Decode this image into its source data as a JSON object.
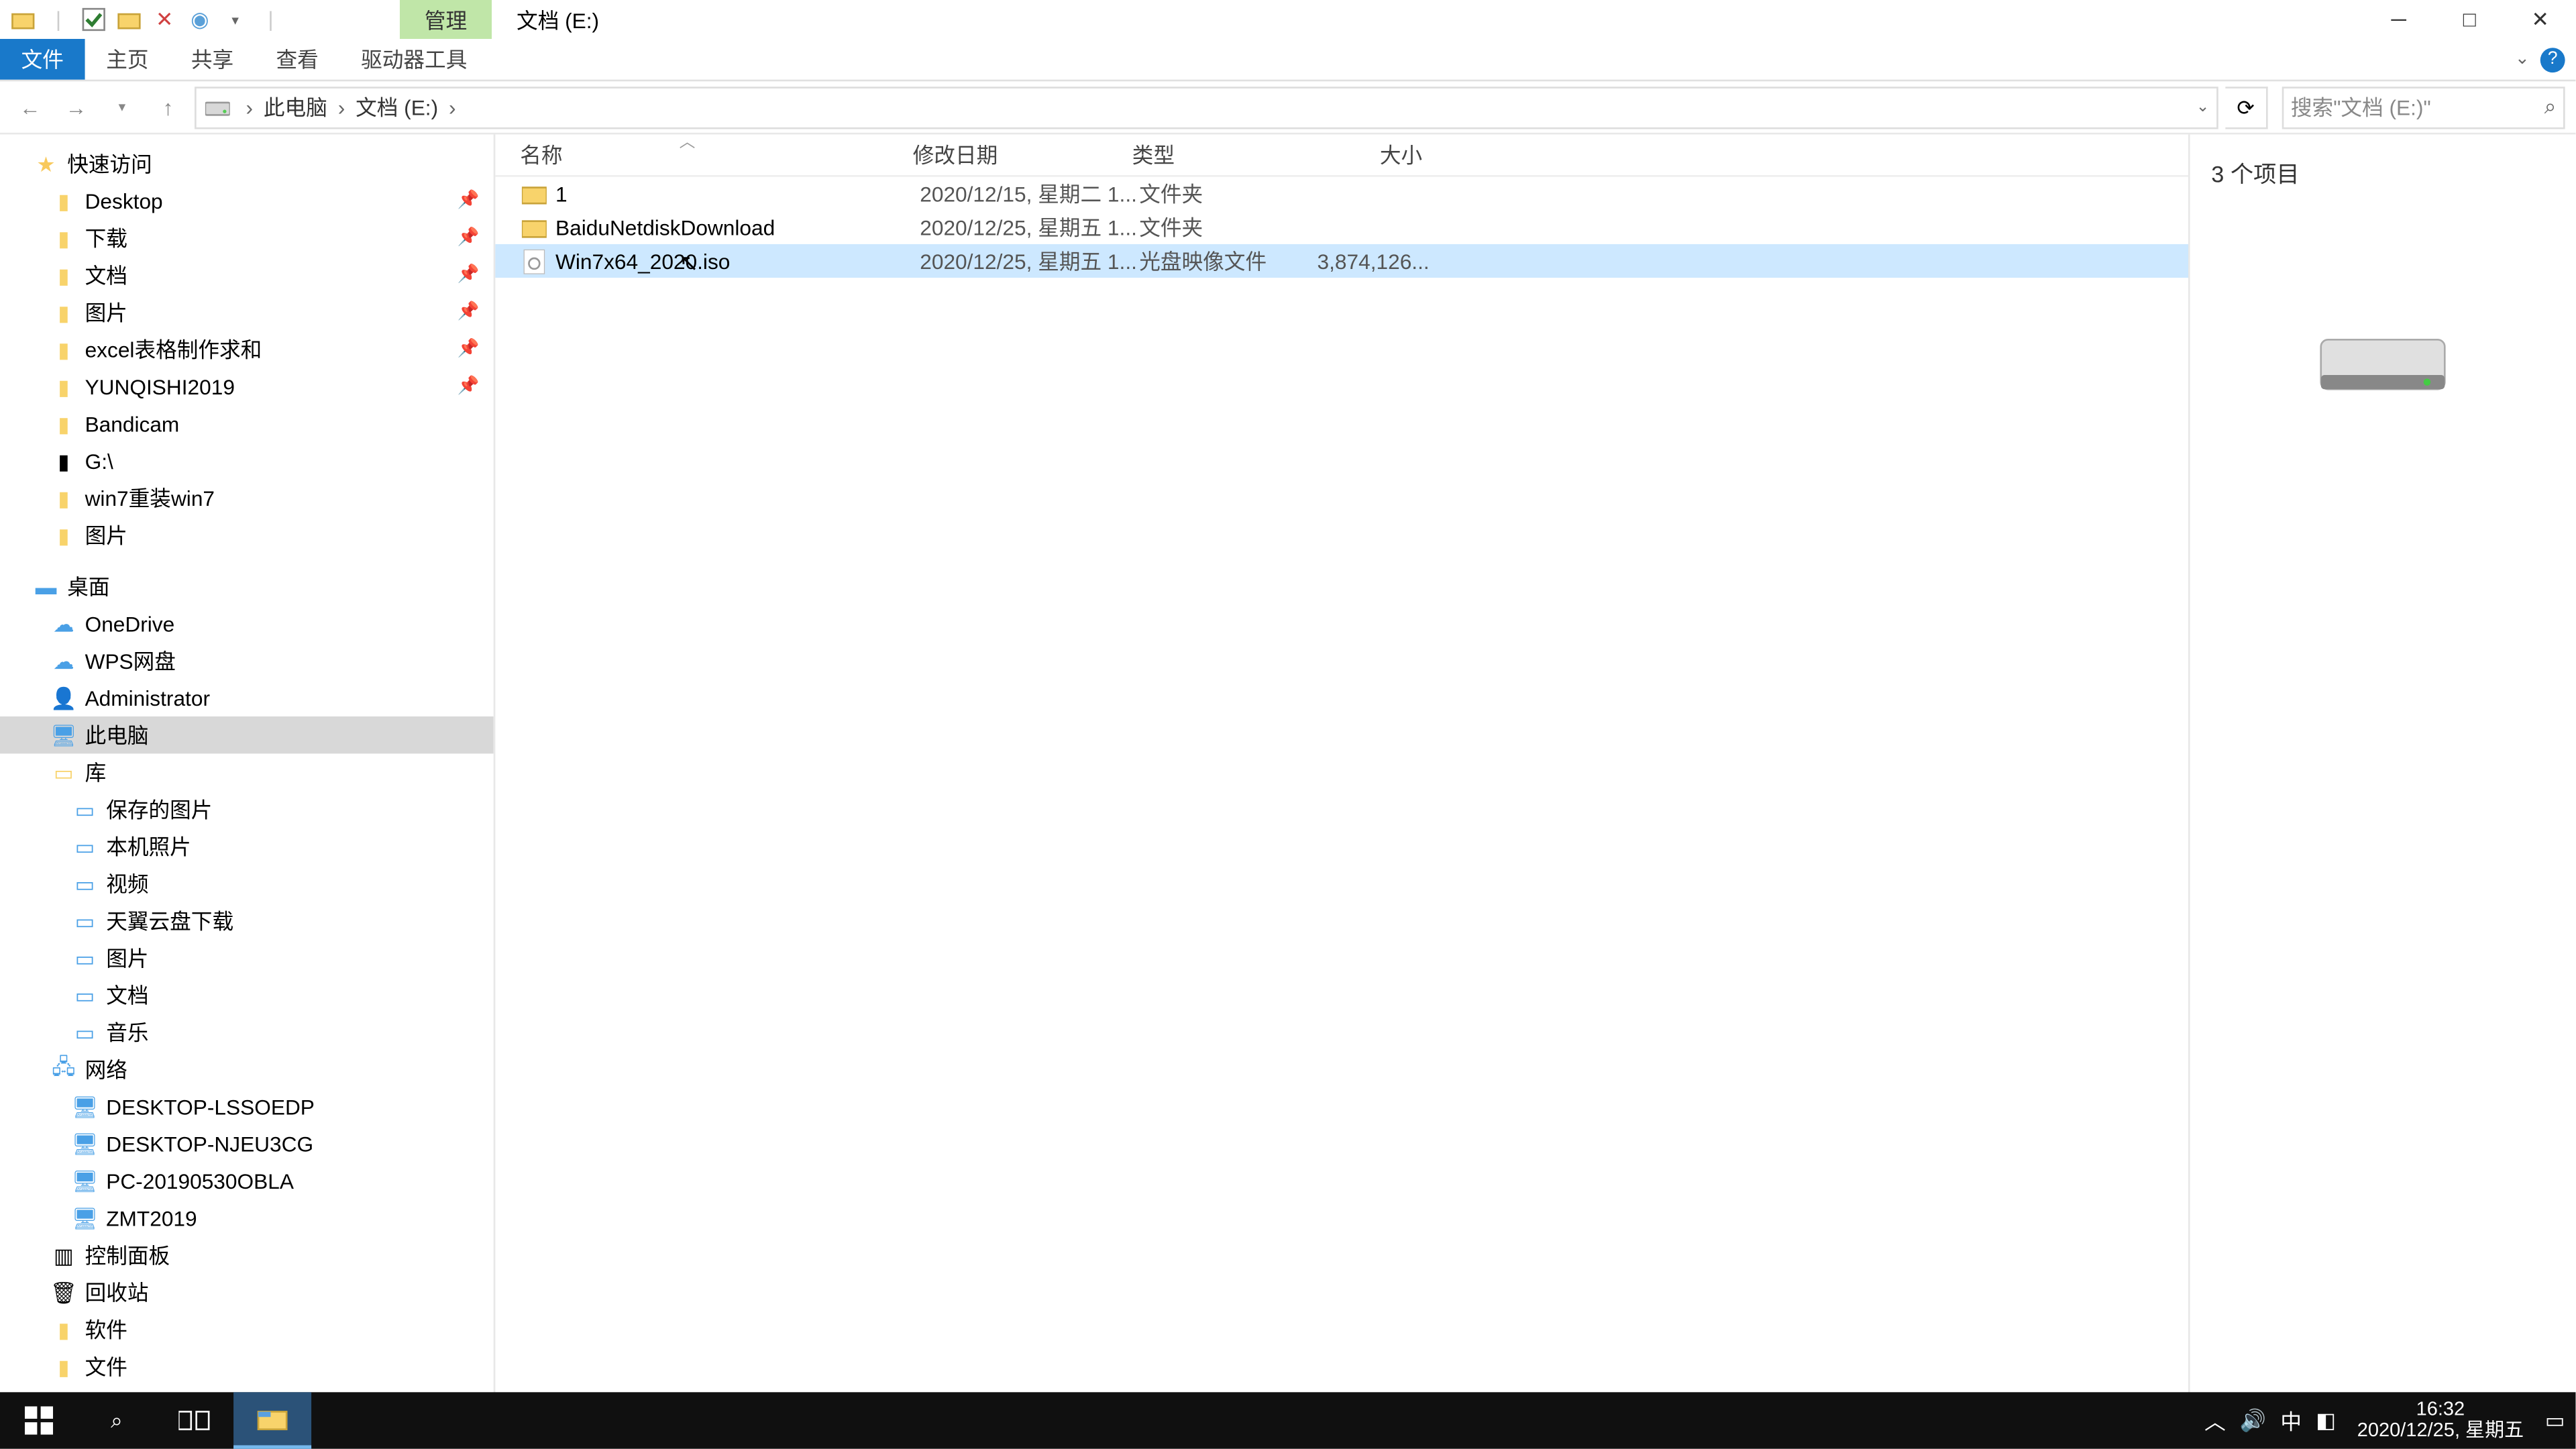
{
  "title_context_tab": "管理",
  "title_location": "文档 (E:)",
  "ribbon": {
    "file": "文件",
    "home": "主页",
    "share": "共享",
    "view": "查看",
    "drive_tools": "驱动器工具"
  },
  "breadcrumb": {
    "pc": "此电脑",
    "drive": "文档 (E:)"
  },
  "search_placeholder": "搜索\"文档 (E:)\"",
  "columns": {
    "name": "名称",
    "date": "修改日期",
    "type": "类型",
    "size": "大小"
  },
  "files": [
    {
      "name": "1",
      "date": "2020/12/15, 星期二 1...",
      "type": "文件夹",
      "size": "",
      "icon": "folder"
    },
    {
      "name": "BaiduNetdiskDownload",
      "date": "2020/12/25, 星期五 1...",
      "type": "文件夹",
      "size": "",
      "icon": "folder"
    },
    {
      "name": "Win7x64_2020.iso",
      "date": "2020/12/25, 星期五 1...",
      "type": "光盘映像文件",
      "size": "3,874,126...",
      "icon": "iso",
      "selected": true
    }
  ],
  "preview_count": "3 个项目",
  "status_text": "3 个项目",
  "tree": {
    "quick": "快速访问",
    "quick_items": [
      "Desktop",
      "下载",
      "文档",
      "图片",
      "excel表格制作求和",
      "YUNQISHI2019",
      "Bandicam",
      "G:\\",
      "win7重装win7",
      "图片"
    ],
    "desktop": "桌面",
    "desktop_items": [
      "OneDrive",
      "WPS网盘",
      "Administrator",
      "此电脑",
      "库"
    ],
    "lib_items": [
      "保存的图片",
      "本机照片",
      "视频",
      "天翼云盘下载",
      "图片",
      "文档",
      "音乐"
    ],
    "network": "网络",
    "net_items": [
      "DESKTOP-LSSOEDP",
      "DESKTOP-NJEU3CG",
      "PC-20190530OBLA",
      "ZMT2019"
    ],
    "control_panel": "控制面板",
    "recycle": "回收站",
    "software": "软件",
    "files_folder": "文件"
  },
  "taskbar": {
    "time": "16:32",
    "date": "2020/12/25, 星期五",
    "ime": "中"
  }
}
